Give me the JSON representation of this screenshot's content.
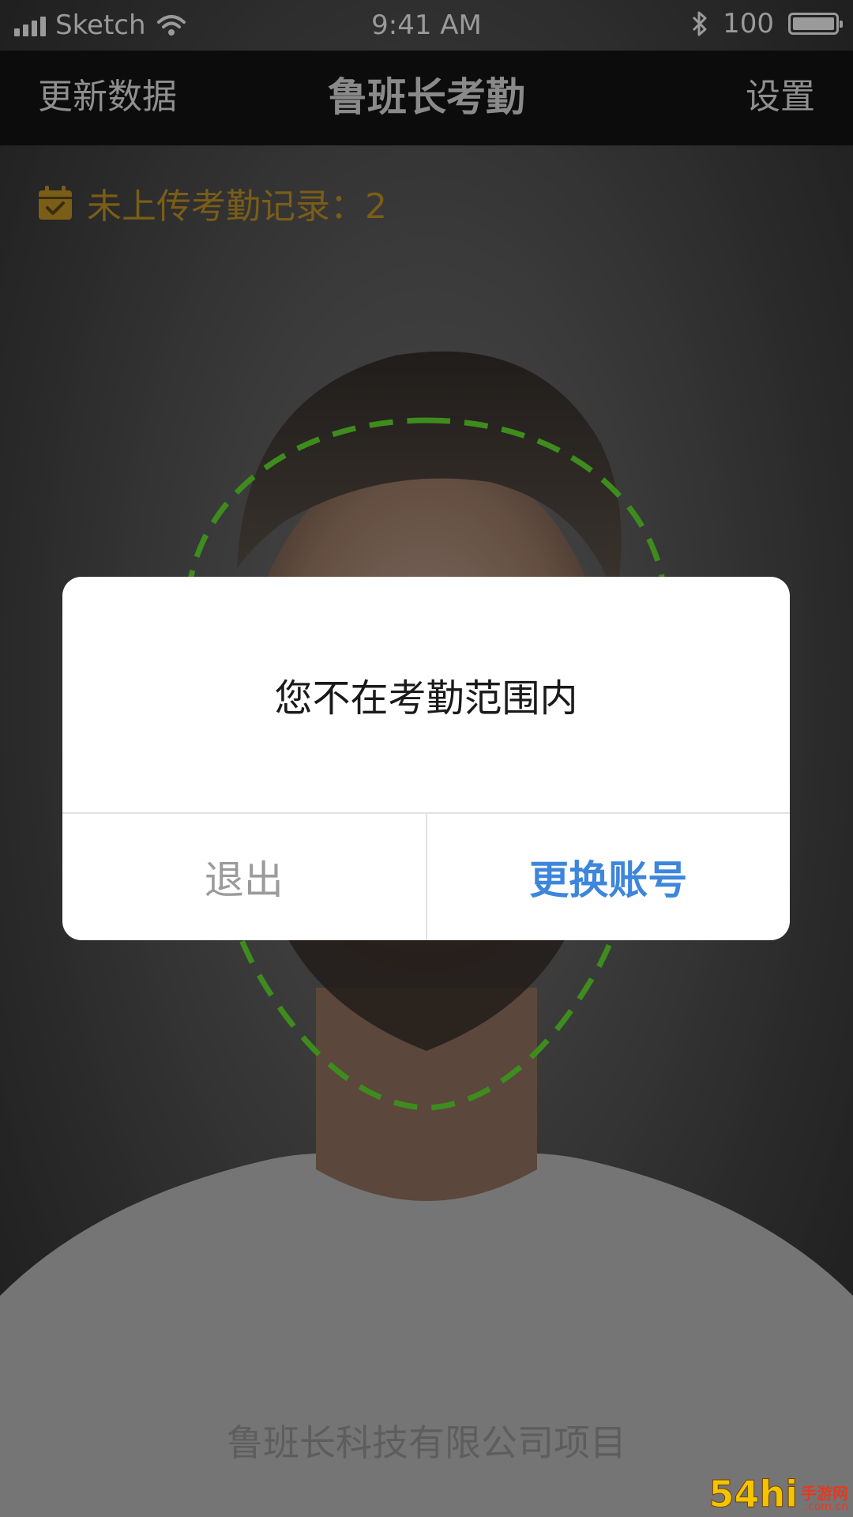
{
  "status_bar": {
    "carrier": "Sketch",
    "time": "9:41 AM",
    "battery": "100",
    "icons": [
      "signal-icon",
      "wifi-icon",
      "bluetooth-icon",
      "battery-icon"
    ]
  },
  "nav": {
    "left_label": "更新数据",
    "title": "鲁班长考勤",
    "right_label": "设置"
  },
  "pending": {
    "icon": "calendar-check-icon",
    "text": "未上传考勤记录：2"
  },
  "dialog": {
    "message": "您不在考勤范围内",
    "cancel_label": "退出",
    "confirm_label": "更换账号"
  },
  "footer": {
    "text": "鲁班长科技有限公司项目"
  },
  "watermark": {
    "main": "54hi",
    "cn": "手游网",
    "domain": ".com.cn"
  },
  "colors": {
    "accent": "#3d86db",
    "face_guide": "#3e8c1d",
    "pending": "#7a5d17",
    "nav_bg": "#0c0c0c"
  }
}
